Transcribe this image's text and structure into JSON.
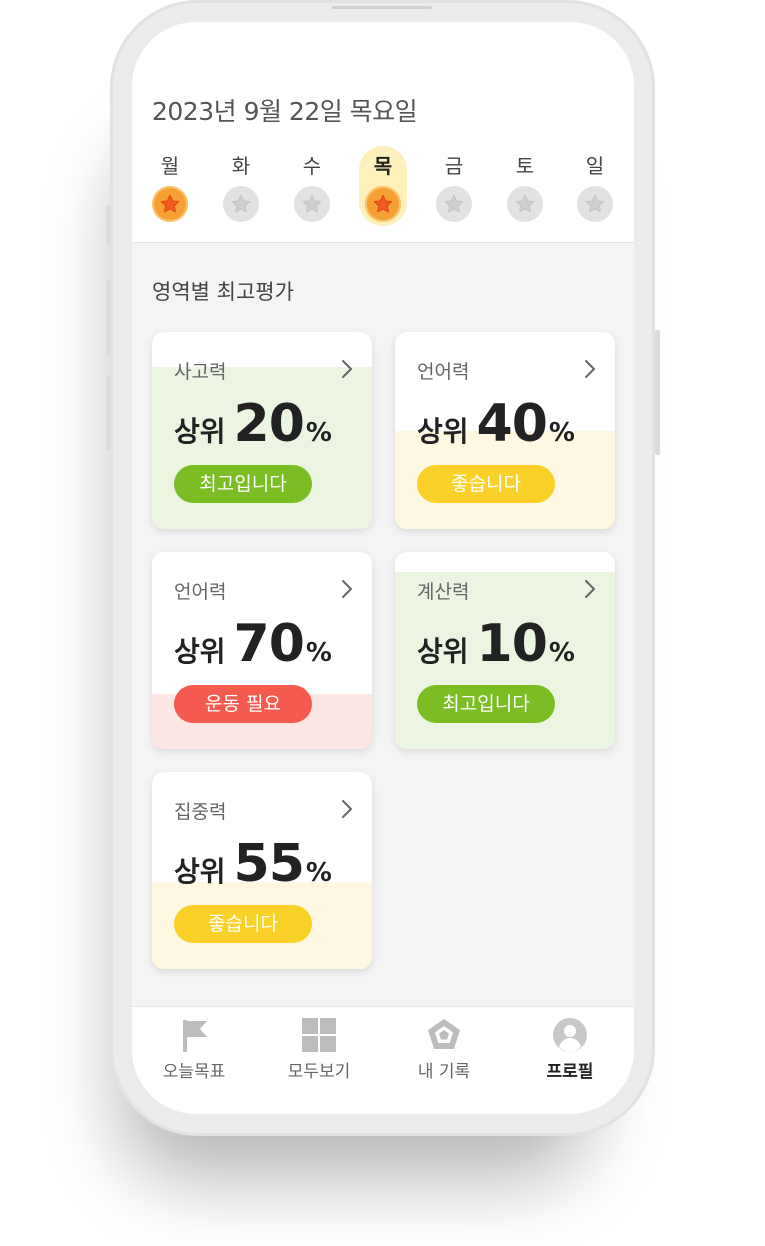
{
  "header": {
    "date": "2023년 9월 22일 목요일",
    "days": [
      {
        "label": "월",
        "starred": true,
        "active": false
      },
      {
        "label": "화",
        "starred": false,
        "active": false
      },
      {
        "label": "수",
        "starred": false,
        "active": false
      },
      {
        "label": "목",
        "starred": true,
        "active": true
      },
      {
        "label": "금",
        "starred": false,
        "active": false
      },
      {
        "label": "토",
        "starred": false,
        "active": false
      },
      {
        "label": "일",
        "starred": false,
        "active": false
      }
    ]
  },
  "section_title": "영역별 최고평가",
  "cards": [
    {
      "title": "사고력",
      "prefix": "상위",
      "value": "20",
      "unit": "%",
      "badge": "최고입니다",
      "badge_color": "#7bbe24",
      "fill_color": "#ecf4e2",
      "fill_fraction": 0.82
    },
    {
      "title": "언어력",
      "prefix": "상위",
      "value": "40",
      "unit": "%",
      "badge": "좋습니다",
      "badge_color": "#fad129",
      "fill_color": "#fef8e2",
      "fill_fraction": 0.5
    },
    {
      "title": "언어력",
      "prefix": "상위",
      "value": "70",
      "unit": "%",
      "badge": "운동 필요",
      "badge_color": "#f55a4e",
      "fill_color": "#fde6e4",
      "fill_fraction": 0.28
    },
    {
      "title": "계산력",
      "prefix": "상위",
      "value": "10",
      "unit": "%",
      "badge": "최고입니다",
      "badge_color": "#7bbe24",
      "fill_color": "#ecf4e2",
      "fill_fraction": 0.9
    },
    {
      "title": "집중력",
      "prefix": "상위",
      "value": "55",
      "unit": "%",
      "badge": "좋습니다",
      "badge_color": "#fad129",
      "fill_color": "#fef8e2",
      "fill_fraction": 0.44
    }
  ],
  "tabbar": {
    "tabs": [
      {
        "label": "오늘목표",
        "icon": "flag-icon",
        "active": false
      },
      {
        "label": "모두보기",
        "icon": "grid-icon",
        "active": false
      },
      {
        "label": "내 기록",
        "icon": "pentagon-icon",
        "active": false
      },
      {
        "label": "프로필",
        "icon": "profile-icon",
        "active": true
      }
    ]
  }
}
